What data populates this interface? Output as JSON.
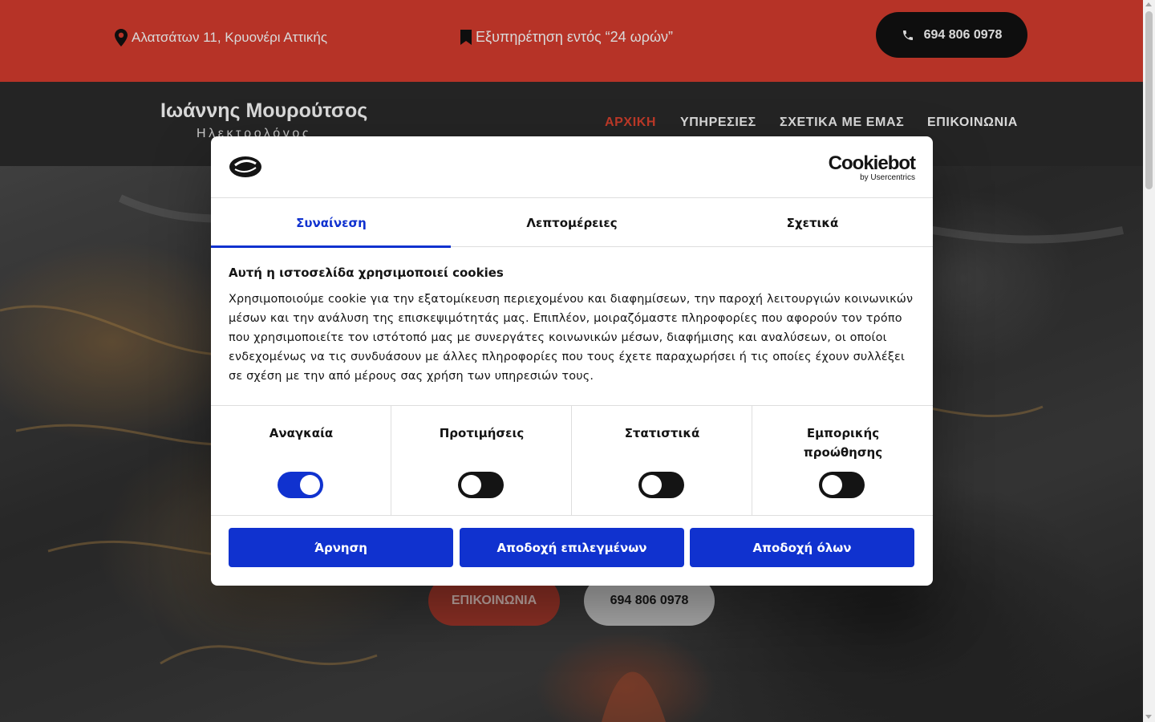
{
  "topbar": {
    "address": "Αλατσάτων 11, Κρυονέρι Αττικής",
    "service": "Εξυπηρέτηση εντός “24 ωρών”",
    "phone": "694 806 0978"
  },
  "brand": {
    "name": "Ιωάννης Μουρούτσος",
    "subtitle": "Ηλεκτρολόγος"
  },
  "nav": [
    {
      "label": "ΑΡΧΙΚΗ",
      "active": true
    },
    {
      "label": "ΥΠΗΡΕΣΙΕΣ",
      "active": false
    },
    {
      "label": "ΣΧΕΤΙΚΑ ΜΕ ΕΜΑΣ",
      "active": false
    },
    {
      "label": "ΕΠΙΚΟΙΝΩΝΙΑ",
      "active": false
    }
  ],
  "hero": {
    "contact_button": "ΕΠΙΚΟΙΝΩΝΙΑ",
    "phone_button": "694 806 0978"
  },
  "cookie_dialog": {
    "brand_main": "Cookiebot",
    "brand_sub": "by Usercentrics",
    "tabs": [
      "Συναίνεση",
      "Λεπτομέρειες",
      "Σχετικά"
    ],
    "active_tab": "Συναίνεση",
    "title": "Αυτή η ιστοσελίδα χρησιμοποιεί cookies",
    "body": "Χρησιμοποιούμε cookie για την εξατομίκευση περιεχομένου και διαφημίσεων, την παροχή λειτουργιών κοινωνικών μέσων και την ανάλυση της επισκεψιμότητάς μας. Επιπλέον, μοιραζόμαστε πληροφορίες που αφορούν τον τρόπο που χρησιμοποιείτε τον ιστότοπό μας με συνεργάτες κοινωνικών μέσων, διαφήμισης και αναλύσεων, οι οποίοι ενδεχομένως να τις συνδυάσουν με άλλες πληροφορίες που τους έχετε παραχωρήσει ή τις οποίες έχουν συλλέξει σε σχέση με την από μέρους σας χρήση των υπηρεσιών τους.",
    "categories": [
      {
        "label": "Αναγκαία",
        "enabled": true
      },
      {
        "label": "Προτιμήσεις",
        "enabled": false
      },
      {
        "label": "Στατιστικά",
        "enabled": false
      },
      {
        "label": "Εμπορικής προώθησης",
        "enabled": false
      }
    ],
    "buttons": {
      "deny": "Άρνηση",
      "accept_selected": "Αποδοχή επιλεγμένων",
      "accept_all": "Αποδοχή όλων"
    }
  },
  "colors": {
    "topbar": "#d63d2e",
    "navbar": "#2b2b2b",
    "accent_blue": "#1032cf",
    "nav_active": "#e0442f"
  }
}
